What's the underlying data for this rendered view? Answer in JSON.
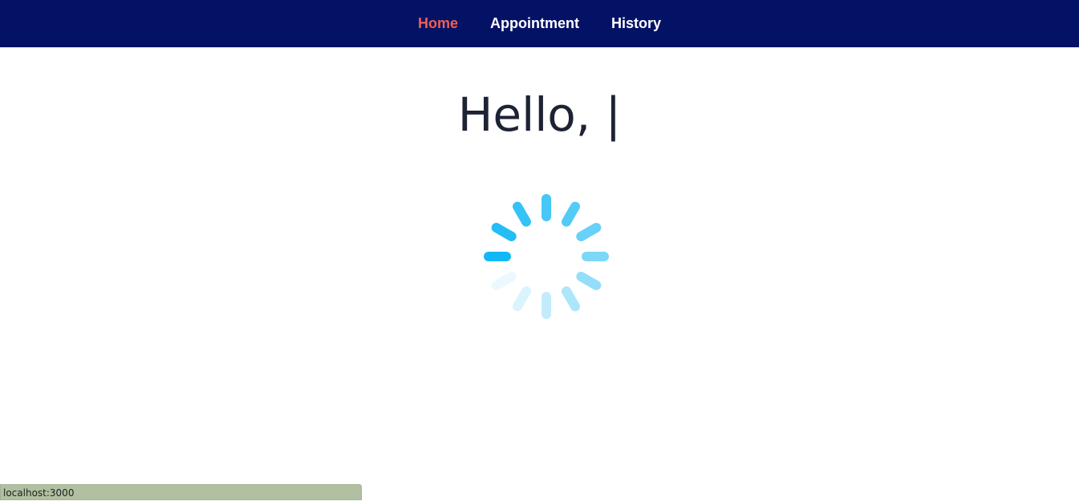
{
  "nav": {
    "items": [
      {
        "label": "Home",
        "active": true
      },
      {
        "label": "Appointment",
        "active": false
      },
      {
        "label": "History",
        "active": false
      }
    ],
    "background_color": "#041266",
    "active_color": "#f0604f"
  },
  "main": {
    "greeting": "Hello, |"
  },
  "loading_spinner": {
    "icon": "loading-spinner-icon",
    "color": "#12b8f5"
  },
  "status_bar": {
    "url": "localhost:3000"
  }
}
